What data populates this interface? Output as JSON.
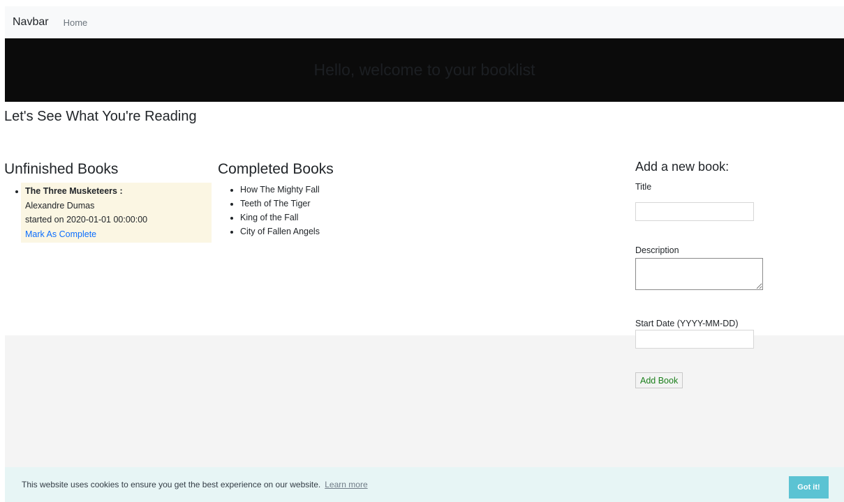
{
  "navbar": {
    "brand": "Navbar",
    "links": [
      "Home"
    ]
  },
  "hero": {
    "title": "Hello, welcome to your booklist"
  },
  "page": {
    "subtitle": "Let's See What You're Reading"
  },
  "unfinished": {
    "heading": "Unfinished Books",
    "books": [
      {
        "title": "The Three Musketeers :",
        "author": "Alexandre Dumas",
        "started": "started on 2020-01-01 00:00:00",
        "action": "Mark As Complete"
      }
    ]
  },
  "completed": {
    "heading": "Completed Books",
    "books": [
      "How The Mighty Fall",
      "Teeth of The Tiger",
      "King of the Fall",
      "City of Fallen Angels"
    ]
  },
  "form": {
    "heading": "Add a new book:",
    "title_label": "Title",
    "title_value": "",
    "description_label": "Description",
    "description_value": "",
    "start_label": "Start Date (YYYY-MM-DD)",
    "start_value": "",
    "submit_label": "Add Book"
  },
  "cookie": {
    "message": "This website uses cookies to ensure you get the best experience on our website.",
    "learn_more": "Learn more",
    "button": "Got it!"
  },
  "colors": {
    "hero_bg": "#0b0b0b",
    "unfinished_card_bg": "#fbf6e3",
    "link": "#0d6efd",
    "add_button_text": "#1a7f1a",
    "cookie_bar_bg": "#e7f5f5",
    "cookie_button_bg": "#5bc3d3"
  }
}
